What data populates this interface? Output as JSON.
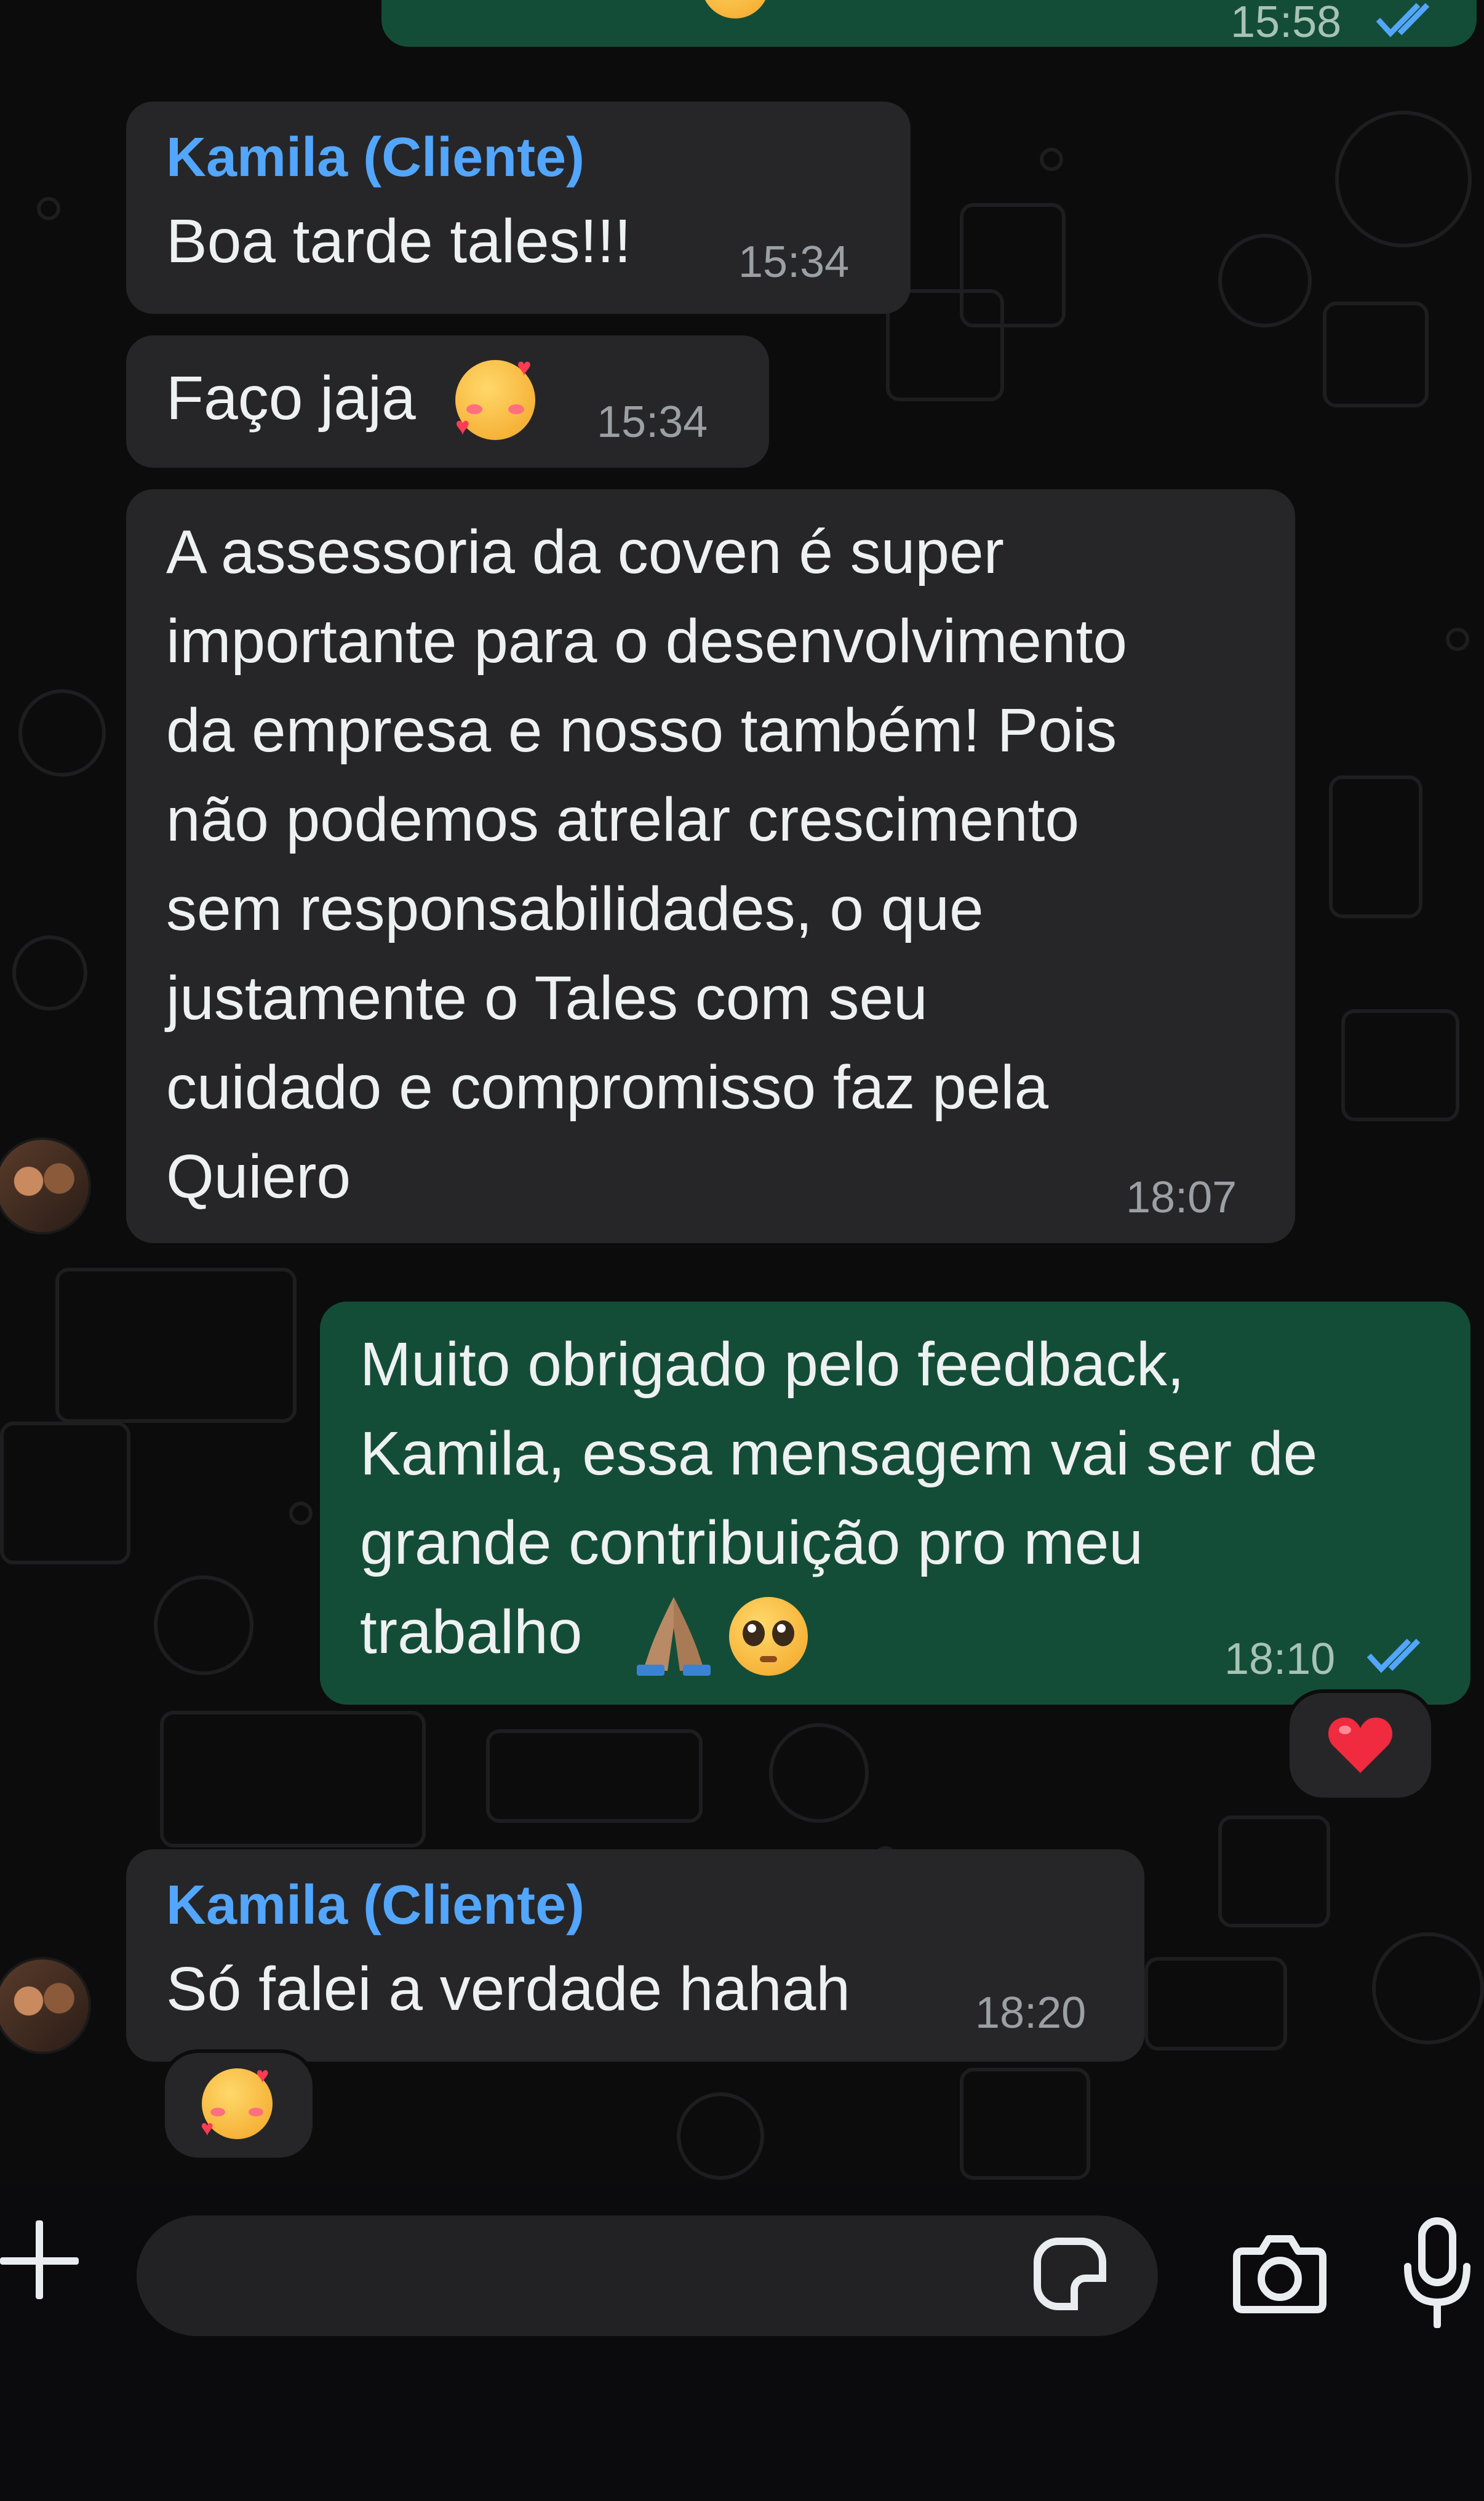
{
  "colors": {
    "background": "#0c0c0c",
    "incoming_bubble": "#262628",
    "outgoing_bubble": "#144d37",
    "sender_name": "#53a6fd",
    "read_ticks": "#53a6fd",
    "text": "#eef1f2",
    "timestamp": "#9ba0a4"
  },
  "top_partial_message": {
    "time": "15:58",
    "status": "read"
  },
  "messages": [
    {
      "direction": "incoming",
      "sender": "Kamila (Cliente)",
      "text": "Boa tarde tales!!!",
      "time": "15:34"
    },
    {
      "direction": "incoming",
      "text": "Faço jaja",
      "emoji": "smiling-face-with-hearts",
      "time": "15:34"
    },
    {
      "direction": "incoming",
      "text": "A assessoria da coven é super\nimportante para o desenvolvimento\nda empresa e nosso também! Pois\nnão podemos atrelar crescimento\nsem responsabilidades, o que\njustamente o Tales com seu\ncuidado e compromisso faz pela\nQuiero",
      "time": "18:07"
    },
    {
      "direction": "outgoing",
      "text": "Muito obrigado pelo feedback,\nKamila, essa mensagem vai ser de\ngrande contribuição pro meu\ntrabalho",
      "emojis": [
        "folded-hands",
        "pleading-face"
      ],
      "time": "18:10",
      "status": "read",
      "reaction": "red-heart"
    },
    {
      "direction": "incoming",
      "sender": "Kamila (Cliente)",
      "text": "Só falei a verdade hahah",
      "time": "18:20",
      "reaction": "smiling-face-with-hearts"
    }
  ],
  "input_bar": {
    "icons": [
      "plus-icon",
      "sticker-icon",
      "camera-icon",
      "microphone-icon"
    ]
  }
}
